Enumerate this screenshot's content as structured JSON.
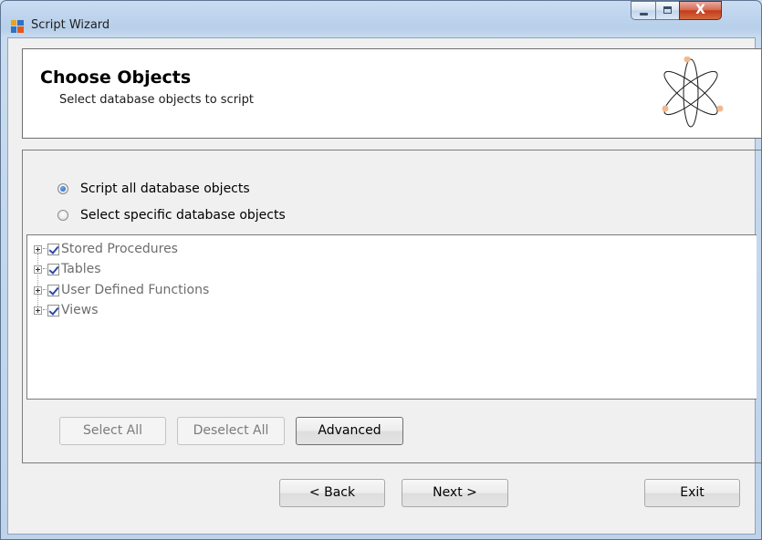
{
  "window": {
    "title": "Script Wizard",
    "controls": {
      "close_glyph": "X"
    }
  },
  "header": {
    "title": "Choose Objects",
    "subtitle": "Select database objects to script",
    "icon": "atom-icon"
  },
  "options": {
    "all_label": "Script all database objects",
    "specific_label": "Select specific database objects",
    "selected": "all"
  },
  "tree": {
    "items": [
      {
        "label": "Stored Procedures",
        "checked": true
      },
      {
        "label": "Tables",
        "checked": true
      },
      {
        "label": "User Defined Functions",
        "checked": true
      },
      {
        "label": "Views",
        "checked": true
      }
    ]
  },
  "selection_buttons": {
    "select_all": "Select All",
    "deselect_all": "Deselect All",
    "advanced": "Advanced"
  },
  "nav": {
    "back": "< Back",
    "next": "Next >",
    "exit": "Exit"
  },
  "colors": {
    "window_frame": "#b9d1ea",
    "close_button": "#c7462b",
    "radio_accent": "#2f6cc4",
    "check_mark": "#2b49a8"
  }
}
